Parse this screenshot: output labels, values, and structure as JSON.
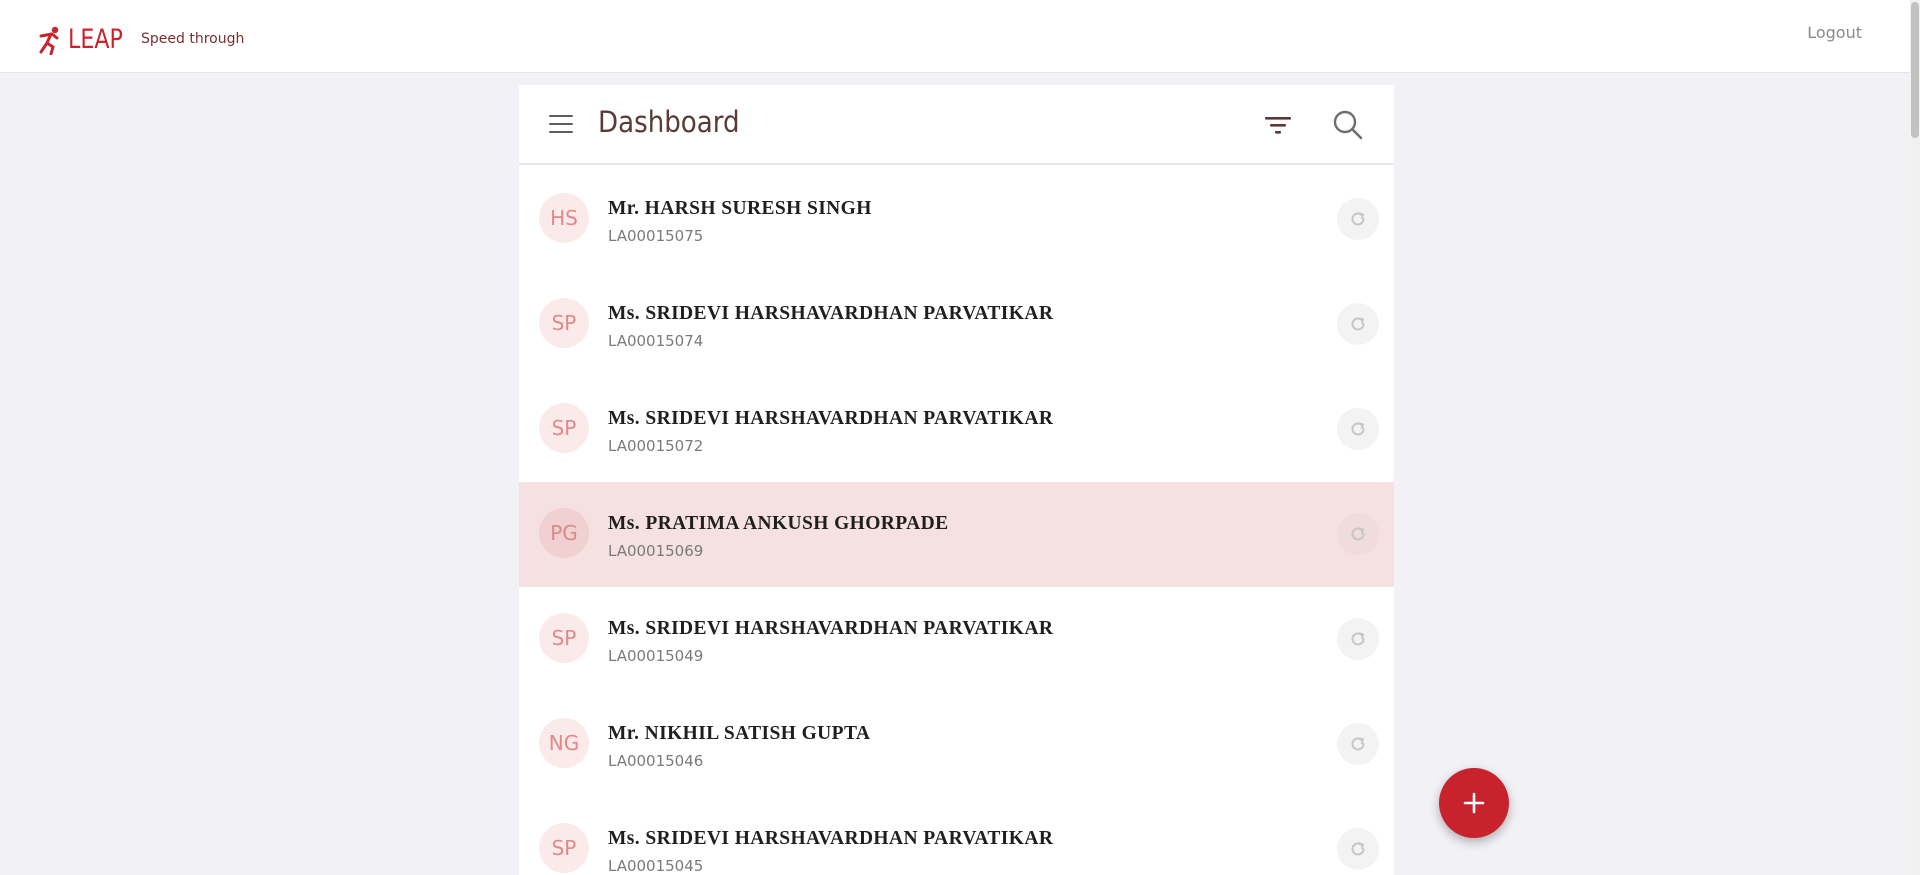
{
  "header": {
    "brand": "LEAP",
    "tagline": "Speed through",
    "logout_label": "Logout"
  },
  "dashboard": {
    "title": "Dashboard"
  },
  "applications": [
    {
      "initials": "HS",
      "name": "Mr. HARSH SURESH SINGH",
      "id": "LA00015075",
      "highlighted": false
    },
    {
      "initials": "SP",
      "name": "Ms. SRIDEVI HARSHAVARDHAN PARVATIKAR",
      "id": "LA00015074",
      "highlighted": false
    },
    {
      "initials": "SP",
      "name": "Ms. SRIDEVI HARSHAVARDHAN PARVATIKAR",
      "id": "LA00015072",
      "highlighted": false
    },
    {
      "initials": "PG",
      "name": "Ms. PRATIMA ANKUSH GHORPADE",
      "id": "LA00015069",
      "highlighted": true
    },
    {
      "initials": "SP",
      "name": "Ms. SRIDEVI HARSHAVARDHAN PARVATIKAR",
      "id": "LA00015049",
      "highlighted": false
    },
    {
      "initials": "NG",
      "name": "Mr. NIKHIL SATISH GUPTA",
      "id": "LA00015046",
      "highlighted": false
    },
    {
      "initials": "SP",
      "name": "Ms. SRIDEVI HARSHAVARDHAN PARVATIKAR",
      "id": "LA00015045",
      "highlighted": false
    }
  ],
  "icons": {
    "menu": "hamburger-icon",
    "filter": "filter-icon",
    "search": "search-icon",
    "refresh": "refresh-icon",
    "add": "plus-icon"
  },
  "colors": {
    "brand": "#c8242e",
    "highlight_row": "#f5e1e1",
    "avatar_bg": "#fbeaea",
    "fab": "#c8232c"
  }
}
